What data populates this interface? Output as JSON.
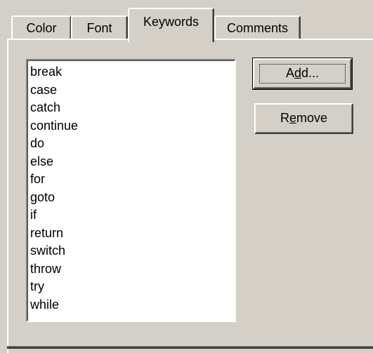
{
  "tabs": [
    {
      "label": "Color"
    },
    {
      "label": "Font"
    },
    {
      "label": "Keywords"
    },
    {
      "label": "Comments"
    }
  ],
  "active_tab": "Keywords",
  "keywords": {
    "items": [
      "break",
      "case",
      "catch",
      "continue",
      "do",
      "else",
      "for",
      "goto",
      "if",
      "return",
      "switch",
      "throw",
      "try",
      "while"
    ]
  },
  "buttons": {
    "add": {
      "pre": "A",
      "mnemonic": "d",
      "post": "d..."
    },
    "remove": {
      "pre": "R",
      "mnemonic": "e",
      "post": "move"
    }
  }
}
